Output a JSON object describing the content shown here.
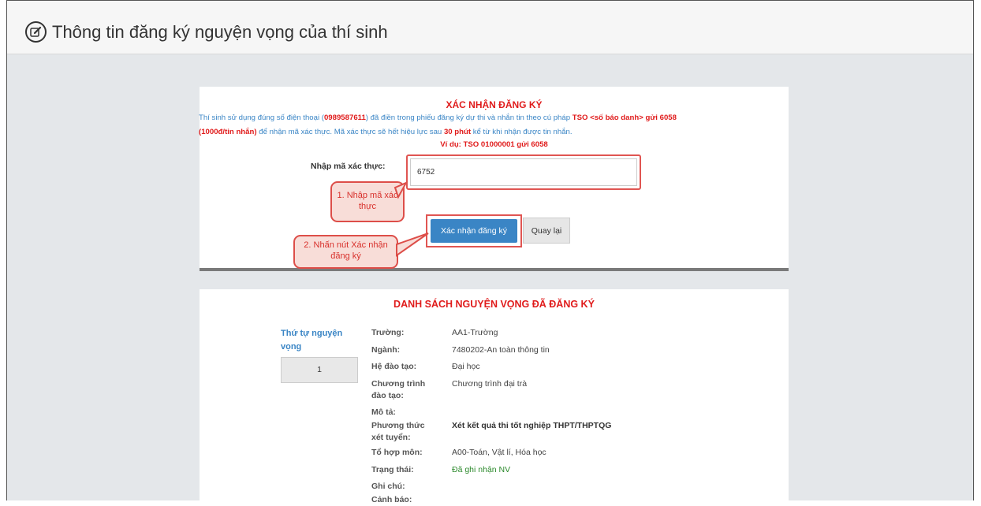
{
  "header": {
    "title": "Thông tin đăng ký nguyện vọng của thí sinh"
  },
  "confirm": {
    "title": "XÁC NHẬN ĐĂNG KÝ",
    "instr_1": "Thí sinh sử dụng đúng số điện thoại (",
    "phone": "0989587611",
    "instr_2": ") đã điền trong phiếu đăng ký dự thi và nhắn tin theo cú pháp ",
    "syntax": "TSO <số báo danh> gửi 6058",
    "fee": "(1000đ/tin nhắn)",
    "instr_3": " để nhận mã xác thực. Mã xác thực sẽ hết hiệu lực sau ",
    "minutes": "30 phút",
    "instr_4": " kể từ khi nhận được tin nhắn.",
    "example": "Ví dụ: TSO 01000001 gửi 6058",
    "code_label": "Nhập mã xác thực:",
    "code_value": "6752",
    "confirm_button": "Xác nhận đăng ký",
    "back_button": "Quay lại"
  },
  "callouts": {
    "step1": "1. Nhập mã xác thực",
    "step2": "2. Nhấn nút Xác nhận đăng ký"
  },
  "wishlist": {
    "title": "DANH SÁCH NGUYỆN VỌNG ĐÃ ĐĂNG KÝ",
    "order_label": "Thứ tự nguyện vọng",
    "order_value": "1",
    "fields": [
      {
        "label": "Trường:",
        "value": "AA1-Trường"
      },
      {
        "label": "Ngành:",
        "value": "7480202-An toàn thông tin"
      },
      {
        "label": "Hệ đào tạo:",
        "value": "Đại học"
      },
      {
        "label": "Chương trình đào tạo:",
        "value": "Chương trình đại trà"
      },
      {
        "label": "Mô tả:",
        "value": ""
      },
      {
        "label": "Phương thức xét tuyển:",
        "value": "Xét kết quả thi tốt nghiệp THPT/THPTQG"
      },
      {
        "label": "Tổ hợp môn:",
        "value": "A00-Toán, Vật lí, Hóa học"
      },
      {
        "label": "Trạng thái:",
        "value": "Đã ghi nhận NV"
      },
      {
        "label": "Ghi chú:",
        "value": ""
      },
      {
        "label": "Cảnh báo:",
        "value": ""
      }
    ]
  }
}
